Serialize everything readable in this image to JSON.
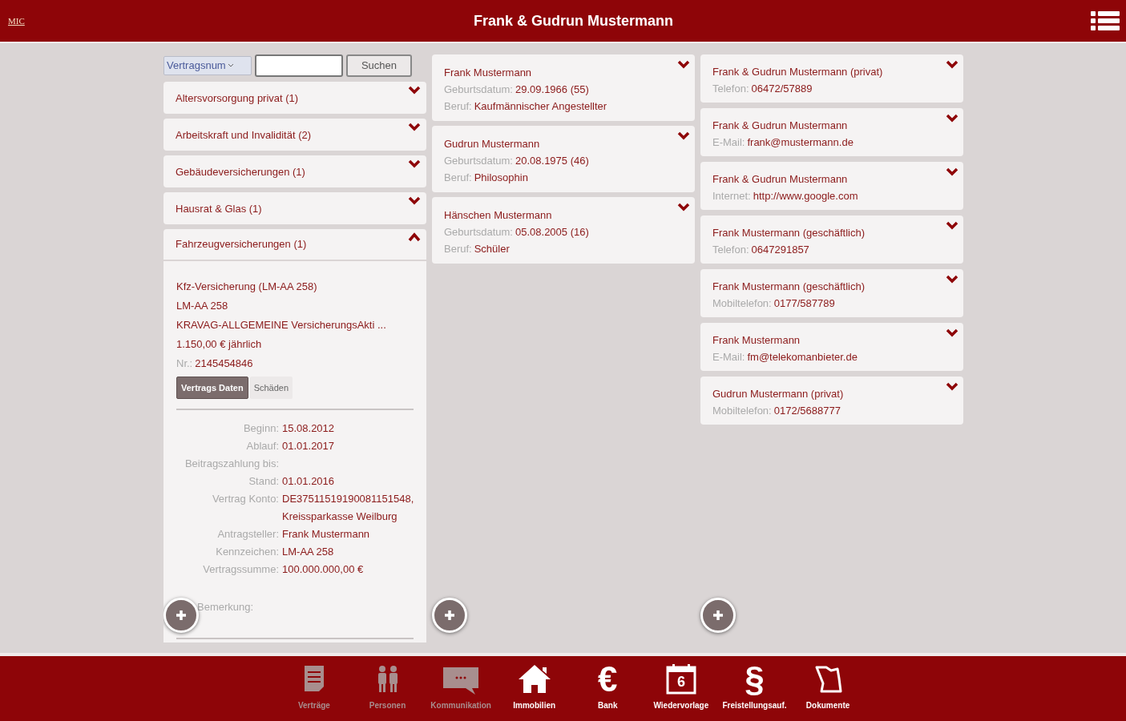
{
  "header": {
    "logo": "MIC",
    "title": "Frank & Gudrun Mustermann"
  },
  "search": {
    "select_value": "Vertragsnum",
    "button": "Suchen"
  },
  "categories": [
    {
      "label": "Altersvorsorgung privat (1)",
      "expanded": false
    },
    {
      "label": "Arbeitskraft und Invalidität (2)",
      "expanded": false
    },
    {
      "label": "Gebäudeversicherungen (1)",
      "expanded": false
    },
    {
      "label": "Hausrat & Glas (1)",
      "expanded": false
    },
    {
      "label": "Fahrzeugversicherungen (1)",
      "expanded": true
    }
  ],
  "contract": {
    "lines": [
      "Kfz-Versicherung (LM-AA 258)",
      "LM-AA 258",
      "KRAVAG-ALLGEMEINE VersicherungsAkti ...",
      "1.150,00 € jährlich"
    ],
    "number_label": "Nr.:",
    "number": "2145454846",
    "tabs": [
      {
        "label": "Vertrags Daten",
        "selected": true
      },
      {
        "label": "Schäden",
        "selected": false
      }
    ],
    "fields": [
      {
        "label": "Beginn:",
        "value": "15.08.2012"
      },
      {
        "label": "Ablauf:",
        "value": "01.01.2017"
      },
      {
        "label": "Beitragszahlung bis:"
      },
      {
        "label": "Stand:",
        "value": "01.01.2016"
      },
      {
        "label": "Vertrag Konto:",
        "value": "DE37511519190081151548, Kreissparkasse Weilburg"
      },
      {
        "label": "Antragsteller:",
        "value": "Frank Mustermann"
      },
      {
        "label": "Kennzeichen:",
        "value": "LM-AA 258"
      },
      {
        "label": "Vertragssumme:",
        "value": "100.000.000,00 €"
      }
    ],
    "remark_label": "Bemerkung:"
  },
  "persons": [
    {
      "name": "Frank Mustermann",
      "rows": [
        {
          "label": "Geburtsdatum:",
          "value": "29.09.1966 (55)"
        },
        {
          "label": "Beruf:",
          "value": "Kaufmännischer Angestellter"
        }
      ]
    },
    {
      "name": "Gudrun Mustermann",
      "rows": [
        {
          "label": "Geburtsdatum:",
          "value": "20.08.1975 (46)"
        },
        {
          "label": "Beruf:",
          "value": "Philosophin"
        }
      ]
    },
    {
      "name": "Hänschen Mustermann",
      "rows": [
        {
          "label": "Geburtsdatum:",
          "value": "05.08.2005 (16)"
        },
        {
          "label": "Beruf:",
          "value": "Schüler"
        }
      ]
    }
  ],
  "contacts": [
    {
      "name": "Frank & Gudrun Mustermann (privat)",
      "label": "Telefon:",
      "value": "06472/57889"
    },
    {
      "name": "Frank & Gudrun Mustermann",
      "label": "E-Mail:",
      "value": "frank@mustermann.de"
    },
    {
      "name": "Frank & Gudrun Mustermann",
      "label": "Internet:",
      "value": "http://www.google.com"
    },
    {
      "name": "Frank Mustermann (geschäftlich)",
      "label": "Telefon:",
      "value": "0647291857"
    },
    {
      "name": "Frank Mustermann (geschäftlich)",
      "label": "Mobiltelefon:",
      "value": "0177/587789"
    },
    {
      "name": "Frank Mustermann",
      "label": "E-Mail:",
      "value": "fm@telekomanbieter.de"
    },
    {
      "name": "Gudrun Mustermann (privat)",
      "label": "Mobiltelefon:",
      "value": "0172/5688777"
    }
  ],
  "nav": [
    {
      "label": "Verträge",
      "kind": "document",
      "disabled": true
    },
    {
      "label": "Personen",
      "kind": "people",
      "disabled": true
    },
    {
      "label": "Kommunikation",
      "kind": "chat",
      "disabled": true
    },
    {
      "label": "Immobilien",
      "kind": "house",
      "disabled": false
    },
    {
      "label": "Bank",
      "kind": "glyph",
      "glyph": "€",
      "disabled": false
    },
    {
      "label": "Wiedervorlage",
      "kind": "calendar",
      "glyph": "6",
      "disabled": false
    },
    {
      "label": "Freistellungsauf.",
      "kind": "glyph",
      "glyph": "§",
      "disabled": false
    },
    {
      "label": "Dokumente",
      "kind": "map",
      "disabled": false
    }
  ]
}
